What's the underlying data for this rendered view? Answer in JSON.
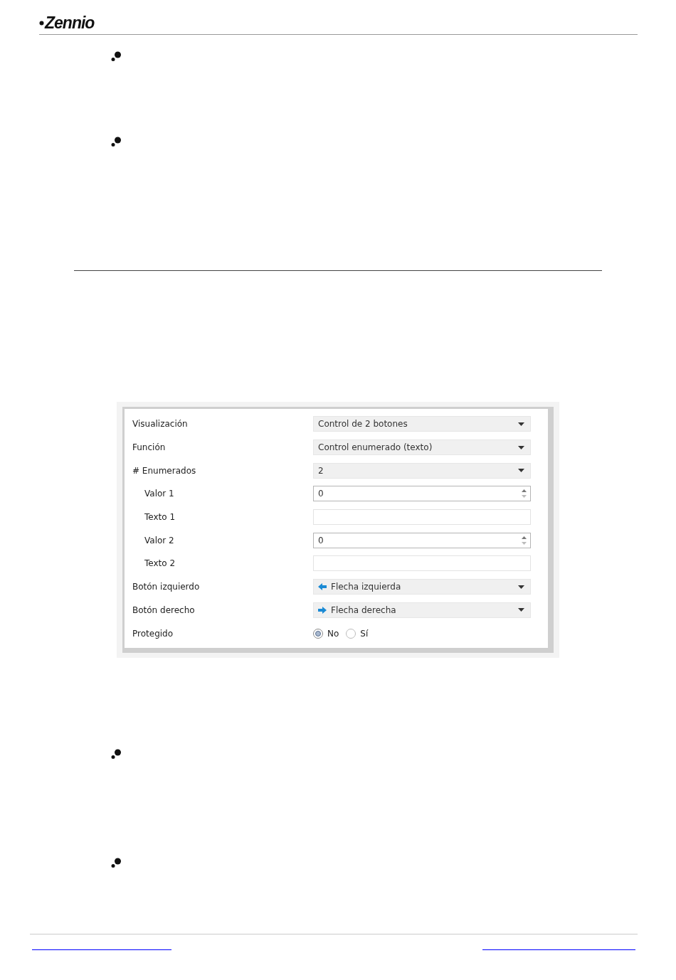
{
  "header": {
    "logo": "Zennio"
  },
  "panel": {
    "rows": [
      {
        "label": "Visualización",
        "kind": "select",
        "value": "Control de 2 botones"
      },
      {
        "label": "Función",
        "kind": "select",
        "value": "Control enumerado (texto)"
      },
      {
        "label": "# Enumerados",
        "kind": "select",
        "value": "2",
        "children": [
          {
            "label": "Valor 1",
            "kind": "spin",
            "value": "0"
          },
          {
            "label": "Texto 1",
            "kind": "text"
          },
          {
            "label": "Valor 2",
            "kind": "spin",
            "value": "0"
          },
          {
            "label": "Texto 2",
            "kind": "text"
          }
        ]
      },
      {
        "label": "Botón izquierdo",
        "kind": "select-left-arrow",
        "value": "Flecha izquierda"
      },
      {
        "label": "Botón derecho",
        "kind": "select-right-arrow",
        "value": "Flecha derecha"
      },
      {
        "label": "Protegido",
        "kind": "radio",
        "options": [
          {
            "label": "No",
            "selected": true
          },
          {
            "label": "Sí",
            "selected": false
          }
        ]
      }
    ]
  }
}
